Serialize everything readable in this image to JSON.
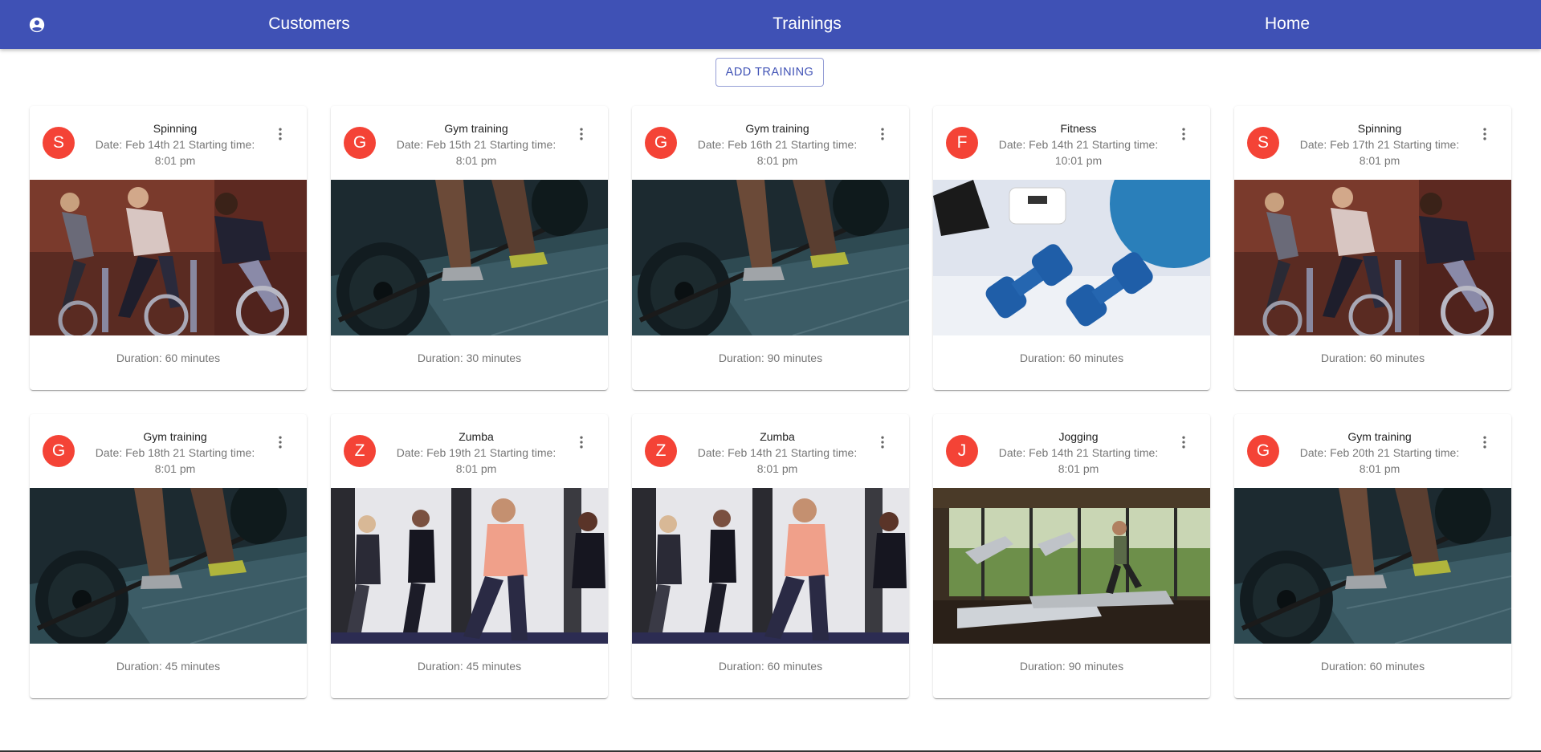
{
  "nav": {
    "customers": "Customers",
    "trainings": "Trainings",
    "home": "Home",
    "account_icon": "account-circle-icon"
  },
  "toolbar": {
    "add_label": "ADD TRAINING"
  },
  "colors": {
    "appbar": "#3f51b5",
    "avatar": "#f44336"
  },
  "cards": [
    {
      "letter": "S",
      "title": "Spinning",
      "date": "Date: Feb 14th 21 Starting time:",
      "time": "8:01 pm",
      "duration": "Duration: 60 minutes",
      "image": "spinning-photo"
    },
    {
      "letter": "G",
      "title": "Gym training",
      "date": "Date: Feb 15th 21 Starting time:",
      "time": "8:01 pm",
      "duration": "Duration: 30 minutes",
      "image": "gym-photo"
    },
    {
      "letter": "G",
      "title": "Gym training",
      "date": "Date: Feb 16th 21 Starting time:",
      "time": "8:01 pm",
      "duration": "Duration: 90 minutes",
      "image": "gym-photo"
    },
    {
      "letter": "F",
      "title": "Fitness",
      "date": "Date: Feb 14th 21 Starting time:",
      "time": "10:01 pm",
      "duration": "Duration: 60 minutes",
      "image": "fitness-photo"
    },
    {
      "letter": "S",
      "title": "Spinning",
      "date": "Date: Feb 17th 21 Starting time:",
      "time": "8:01 pm",
      "duration": "Duration: 60 minutes",
      "image": "spinning-photo"
    },
    {
      "letter": "G",
      "title": "Gym training",
      "date": "Date: Feb 18th 21 Starting time:",
      "time": "8:01 pm",
      "duration": "Duration: 45 minutes",
      "image": "gym-photo"
    },
    {
      "letter": "Z",
      "title": "Zumba",
      "date": "Date: Feb 19th 21 Starting time:",
      "time": "8:01 pm",
      "duration": "Duration: 45 minutes",
      "image": "zumba-photo"
    },
    {
      "letter": "Z",
      "title": "Zumba",
      "date": "Date: Feb 14th 21 Starting time:",
      "time": "8:01 pm",
      "duration": "Duration: 60 minutes",
      "image": "zumba-photo"
    },
    {
      "letter": "J",
      "title": "Jogging",
      "date": "Date: Feb 14th 21 Starting time:",
      "time": "8:01 pm",
      "duration": "Duration: 90 minutes",
      "image": "jogging-photo"
    },
    {
      "letter": "G",
      "title": "Gym training",
      "date": "Date: Feb 20th 21 Starting time:",
      "time": "8:01 pm",
      "duration": "Duration: 60 minutes",
      "image": "gym-photo"
    }
  ]
}
